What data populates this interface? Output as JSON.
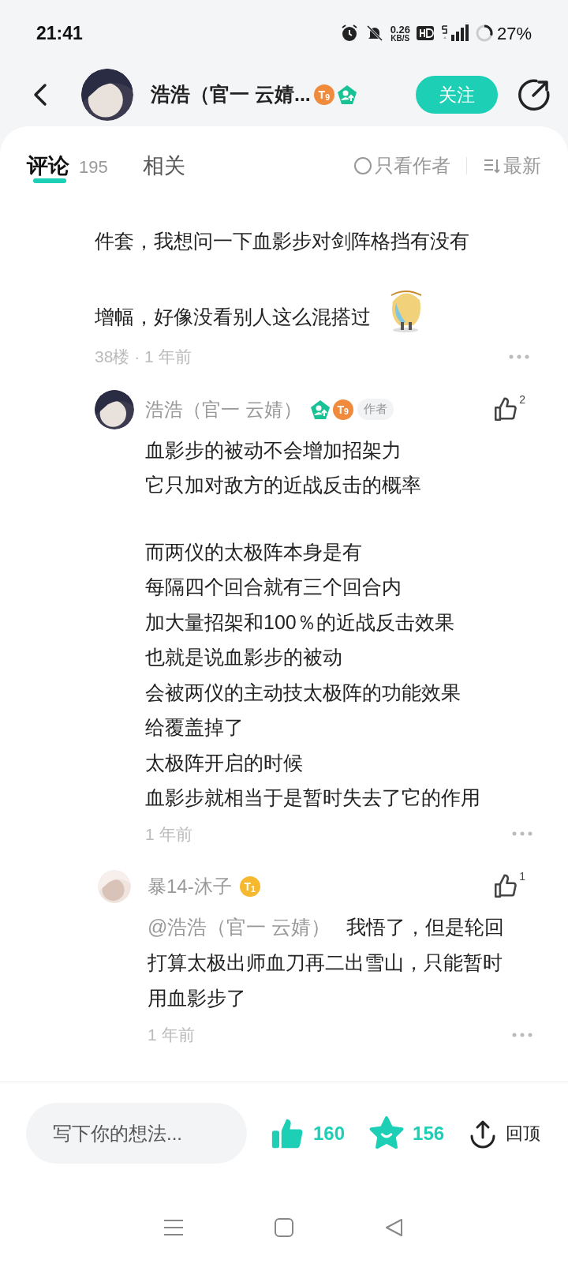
{
  "status_bar": {
    "time": "21:41",
    "speed": "0.26",
    "speed_unit": "KB/S",
    "battery": "27%"
  },
  "header": {
    "name": "浩浩（官一 云婧...",
    "level": "T$_{9}$",
    "follow": "关注"
  },
  "tabs": [
    {
      "label": "评论",
      "count": "195",
      "selected": true
    },
    {
      "label": "相关",
      "selected": false
    }
  ],
  "filters": {
    "author_only": {
      "label": "只看作者",
      "checked": false
    },
    "sort": "最新"
  },
  "comment": {
    "lines": [
      "件套，我想问一下血影步对剑阵格挡有没有",
      "增幅，好像没看别人这么混搭过"
    ],
    "meta": "38楼 · 1 年前",
    "replies": [
      {
        "name": "浩浩（官一 云婧）",
        "level": "T$_{9}$",
        "author_tag": "作者",
        "likes": "2",
        "paragraphs": [
          [
            "血影步的被动不会增加招架力",
            "它只加对敌方的近战反击的概率"
          ],
          [
            "而两仪的太极阵本身是有",
            "每隔四个回合就有三个回合内",
            "加大量招架和100％的近战反击效果",
            "也就是说血影步的被动",
            "会被两仪的主动技太极阵的功能效果",
            "给覆盖掉了",
            "太极阵开启的时候",
            "血影步就相当于是暂时失去了它的作用"
          ]
        ],
        "time": "1 年前"
      },
      {
        "name": "暴14-沐子",
        "level": "T$_{1}$",
        "likes": "1",
        "mention": "@浩浩（官一 云婧）",
        "text": "我悟了，但是轮回打算太极出师血刀再二出雪山，只能暂时用血影步了",
        "time": "1 年前"
      }
    ]
  },
  "bottom_bar": {
    "placeholder": "写下你的想法...",
    "likes": "160",
    "favorites": "156",
    "top": "回顶"
  }
}
